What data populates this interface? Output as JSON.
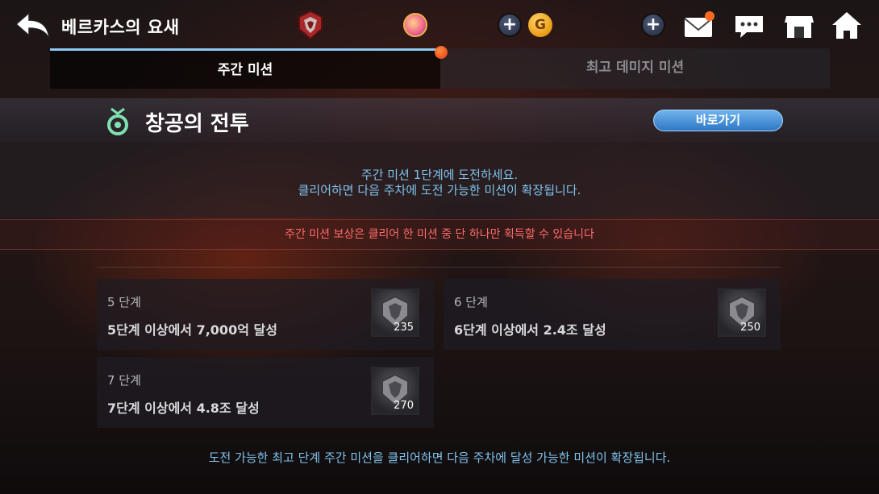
{
  "header": {
    "title": "베르카스의 요새",
    "back_icon": "back-arrow-icon",
    "emblem_icon": "dragon-emblem-icon",
    "orb_icon": "gem-orb-icon",
    "plus_label": "+",
    "gold_label": "G",
    "mail_icon": "mail-icon",
    "chat_icon": "chat-icon",
    "shop_icon": "shop-icon",
    "home_icon": "home-icon"
  },
  "tabs": [
    {
      "label": "주간 미션",
      "active": true
    },
    {
      "label": "최고 데미지 미션",
      "active": false
    }
  ],
  "section": {
    "title": "창공의 전투",
    "goto_label": "바로가기"
  },
  "description": {
    "line1": "주간 미션 1단계에 도전하세요.",
    "line2": "클리어하면 다음 주차에 도전 가능한 미션이 확장됩니다.",
    "notice": "주간 미션 보상은 클리어 한 미션 중 단 하나만 획득할 수 있습니다"
  },
  "missions": [
    {
      "step": "5 단계",
      "desc": "5단계 이상에서 7,000억 달성",
      "reward": "235"
    },
    {
      "step": "6 단계",
      "desc": "6단계 이상에서 2.4조 달성",
      "reward": "250"
    },
    {
      "step": "7 단계",
      "desc": "7단계 이상에서 4.8조 달성",
      "reward": "270"
    }
  ],
  "footer": "도전 가능한 최고 단계 주간 미션을 클리어하면 다음 주차에 달성 가능한 미션이 확장됩니다.",
  "colors": {
    "accent_blue": "#7ec3ee",
    "notice_red": "#ff6b6b",
    "alert_orange": "#ff6a1f",
    "button_blue": "#2f77c4"
  }
}
